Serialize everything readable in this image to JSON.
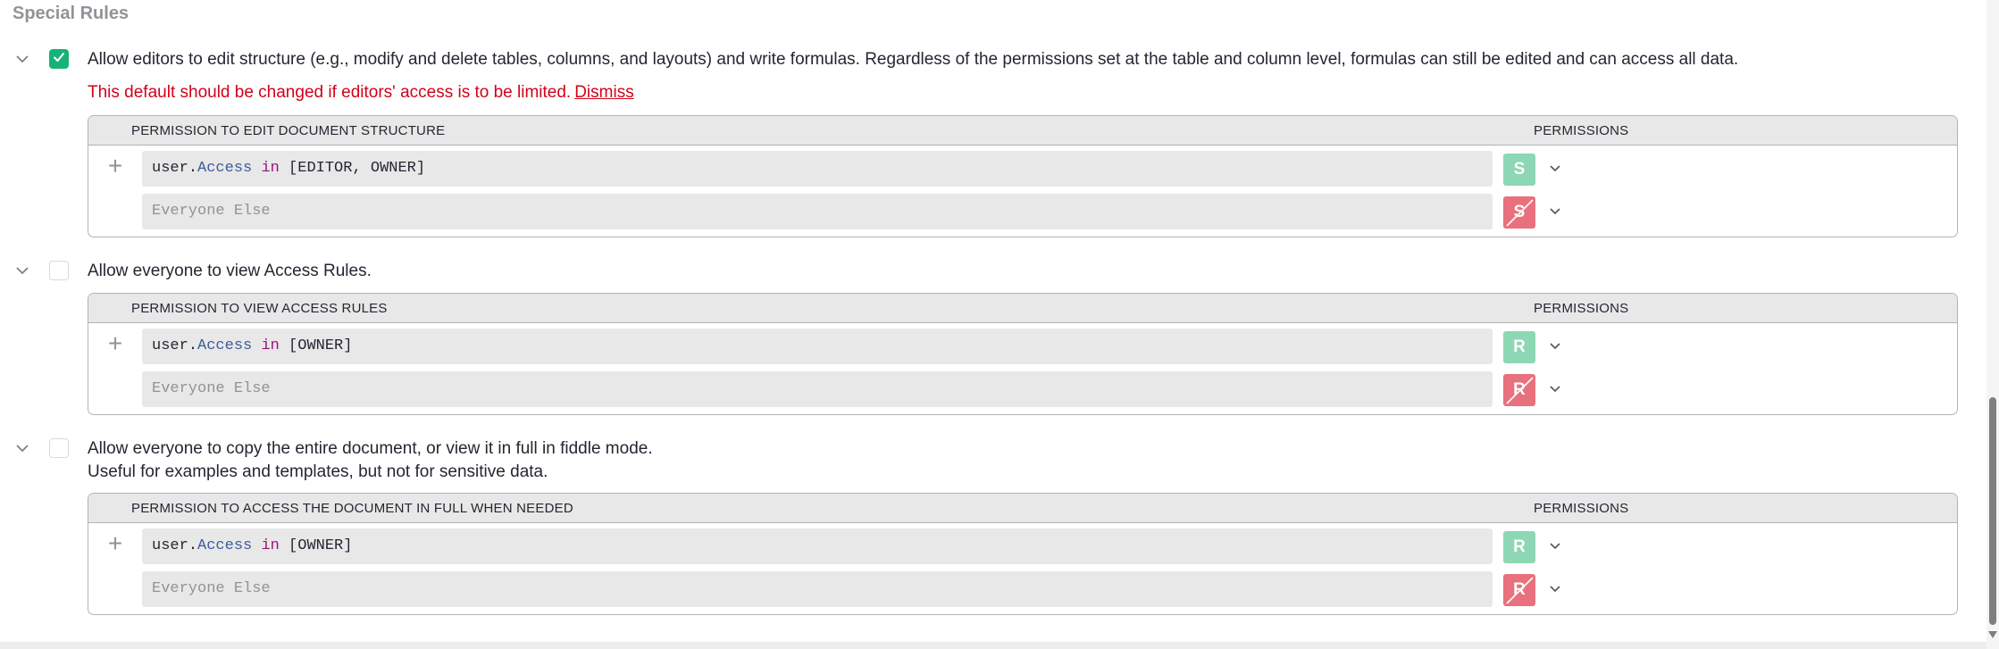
{
  "section_title": "Special Rules",
  "rules": [
    {
      "checked": true,
      "description_line1": "Allow editors to edit structure (e.g., modify and delete tables, columns, and layouts) and write formulas. Regardless of the permissions set at the table and column level, formulas can still be edited and can access all data.",
      "description_line2": "",
      "warning": "This default should be changed if editors' access is to be limited.",
      "dismiss_label": "Dismiss",
      "header_left": "PERMISSION TO EDIT DOCUMENT STRUCTURE",
      "header_right": "PERMISSIONS",
      "condition": {
        "var": "user",
        "dot": ".",
        "attr": "Access",
        "op": "in",
        "list": "[EDITOR, OWNER]"
      },
      "permission_allow": "S",
      "else_placeholder": "Everyone Else",
      "permission_deny": "S"
    },
    {
      "checked": false,
      "description_line1": "Allow everyone to view Access Rules.",
      "description_line2": "",
      "header_left": "PERMISSION TO VIEW ACCESS RULES",
      "header_right": "PERMISSIONS",
      "condition": {
        "var": "user",
        "dot": ".",
        "attr": "Access",
        "op": "in",
        "list": "[OWNER]"
      },
      "permission_allow": "R",
      "else_placeholder": "Everyone Else",
      "permission_deny": "R"
    },
    {
      "checked": false,
      "description_line1": "Allow everyone to copy the entire document, or view it in full in fiddle mode.",
      "description_line2": "Useful for examples and templates, but not for sensitive data.",
      "header_left": "PERMISSION TO ACCESS THE DOCUMENT IN FULL WHEN NEEDED",
      "header_right": "PERMISSIONS",
      "condition": {
        "var": "user",
        "dot": ".",
        "attr": "Access",
        "op": "in",
        "list": "[OWNER]"
      },
      "permission_allow": "R",
      "else_placeholder": "Everyone Else",
      "permission_deny": "R"
    }
  ],
  "icons": {
    "expand": "chevron-down-icon",
    "check": "check-icon",
    "add": "plus-icon",
    "permission_menu": "chevron-down-icon"
  },
  "colors": {
    "checkbox_checked": "#16b378",
    "allow": "#8dd7b4",
    "deny": "#e8717d",
    "warning": "#d0021b"
  }
}
